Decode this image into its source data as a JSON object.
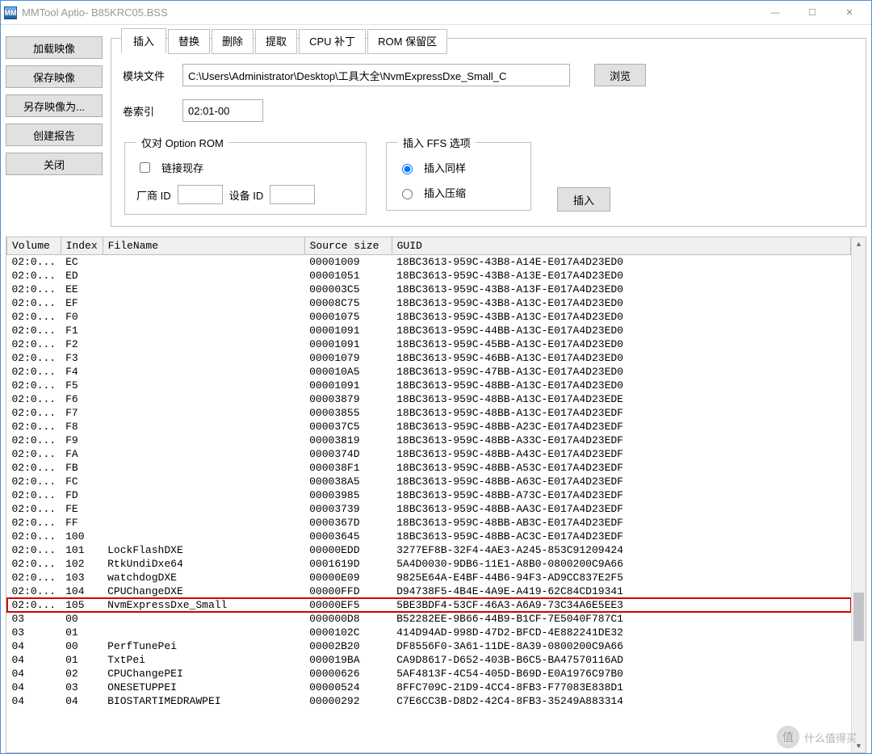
{
  "window": {
    "title": "MMTool Aptio- B85KRC05.BSS",
    "icon_label": "MM"
  },
  "left_buttons": {
    "load": "加载映像",
    "save": "保存映像",
    "saveas": "另存映像为...",
    "report": "创建报告",
    "close": "关闭"
  },
  "tabs": [
    "插入",
    "替换",
    "删除",
    "提取",
    "CPU 补丁",
    "ROM 保留区"
  ],
  "form": {
    "module_file_label": "模块文件",
    "module_file_value": "C:\\Users\\Administrator\\Desktop\\工具大全\\NvmExpressDxe_Small_C",
    "browse": "浏览",
    "volume_index_label": "卷索引",
    "volume_index_value": "02:01-00",
    "option_rom_legend": "仅对 Option ROM",
    "link_existing": "链接现存",
    "vendor_id": "厂商 ID",
    "device_id": "设备 ID",
    "ffs_legend": "插入 FFS 选项",
    "insert_same": "插入同样",
    "insert_compressed": "插入压缩",
    "insert_btn": "插入"
  },
  "columns": [
    "Volume",
    "Index",
    "FileName",
    "Source size",
    "GUID"
  ],
  "rows": [
    {
      "vol": "02:0...",
      "idx": "EC",
      "fn": "",
      "sz": "00001009",
      "guid": "18BC3613-959C-43B8-A14E-E017A4D23ED0"
    },
    {
      "vol": "02:0...",
      "idx": "ED",
      "fn": "",
      "sz": "00001051",
      "guid": "18BC3613-959C-43B8-A13E-E017A4D23ED0"
    },
    {
      "vol": "02:0...",
      "idx": "EE",
      "fn": "",
      "sz": "000003C5",
      "guid": "18BC3613-959C-43B8-A13F-E017A4D23ED0"
    },
    {
      "vol": "02:0...",
      "idx": "EF",
      "fn": "",
      "sz": "00008C75",
      "guid": "18BC3613-959C-43B8-A13C-E017A4D23ED0"
    },
    {
      "vol": "02:0...",
      "idx": "F0",
      "fn": "",
      "sz": "00001075",
      "guid": "18BC3613-959C-43BB-A13C-E017A4D23ED0"
    },
    {
      "vol": "02:0...",
      "idx": "F1",
      "fn": "",
      "sz": "00001091",
      "guid": "18BC3613-959C-44BB-A13C-E017A4D23ED0"
    },
    {
      "vol": "02:0...",
      "idx": "F2",
      "fn": "",
      "sz": "00001091",
      "guid": "18BC3613-959C-45BB-A13C-E017A4D23ED0"
    },
    {
      "vol": "02:0...",
      "idx": "F3",
      "fn": "",
      "sz": "00001079",
      "guid": "18BC3613-959C-46BB-A13C-E017A4D23ED0"
    },
    {
      "vol": "02:0...",
      "idx": "F4",
      "fn": "",
      "sz": "000010A5",
      "guid": "18BC3613-959C-47BB-A13C-E017A4D23ED0"
    },
    {
      "vol": "02:0...",
      "idx": "F5",
      "fn": "",
      "sz": "00001091",
      "guid": "18BC3613-959C-48BB-A13C-E017A4D23ED0"
    },
    {
      "vol": "02:0...",
      "idx": "F6",
      "fn": "",
      "sz": "00003879",
      "guid": "18BC3613-959C-48BB-A13C-E017A4D23EDE"
    },
    {
      "vol": "02:0...",
      "idx": "F7",
      "fn": "",
      "sz": "00003855",
      "guid": "18BC3613-959C-48BB-A13C-E017A4D23EDF"
    },
    {
      "vol": "02:0...",
      "idx": "F8",
      "fn": "",
      "sz": "000037C5",
      "guid": "18BC3613-959C-48BB-A23C-E017A4D23EDF"
    },
    {
      "vol": "02:0...",
      "idx": "F9",
      "fn": "",
      "sz": "00003819",
      "guid": "18BC3613-959C-48BB-A33C-E017A4D23EDF"
    },
    {
      "vol": "02:0...",
      "idx": "FA",
      "fn": "",
      "sz": "0000374D",
      "guid": "18BC3613-959C-48BB-A43C-E017A4D23EDF"
    },
    {
      "vol": "02:0...",
      "idx": "FB",
      "fn": "",
      "sz": "000038F1",
      "guid": "18BC3613-959C-48BB-A53C-E017A4D23EDF"
    },
    {
      "vol": "02:0...",
      "idx": "FC",
      "fn": "",
      "sz": "000038A5",
      "guid": "18BC3613-959C-48BB-A63C-E017A4D23EDF"
    },
    {
      "vol": "02:0...",
      "idx": "FD",
      "fn": "",
      "sz": "00003985",
      "guid": "18BC3613-959C-48BB-A73C-E017A4D23EDF"
    },
    {
      "vol": "02:0...",
      "idx": "FE",
      "fn": "",
      "sz": "00003739",
      "guid": "18BC3613-959C-48BB-AA3C-E017A4D23EDF"
    },
    {
      "vol": "02:0...",
      "idx": "FF",
      "fn": "",
      "sz": "0000367D",
      "guid": "18BC3613-959C-48BB-AB3C-E017A4D23EDF"
    },
    {
      "vol": "02:0...",
      "idx": "100",
      "fn": "",
      "sz": "00003645",
      "guid": "18BC3613-959C-48BB-AC3C-E017A4D23EDF"
    },
    {
      "vol": "02:0...",
      "idx": "101",
      "fn": "LockFlashDXE",
      "sz": "00000EDD",
      "guid": "3277EF8B-32F4-4AE3-A245-853C91209424"
    },
    {
      "vol": "02:0...",
      "idx": "102",
      "fn": "RtkUndiDxe64",
      "sz": "0001619D",
      "guid": "5A4D0030-9DB6-11E1-A8B0-0800200C9A66"
    },
    {
      "vol": "02:0...",
      "idx": "103",
      "fn": "watchdogDXE",
      "sz": "00000E09",
      "guid": "9825E64A-E4BF-44B6-94F3-AD9CC837E2F5"
    },
    {
      "vol": "02:0...",
      "idx": "104",
      "fn": "CPUChangeDXE",
      "sz": "00000FFD",
      "guid": "D94738F5-4B4E-4A9E-A419-62C84CD19341"
    },
    {
      "vol": "02:0...",
      "idx": "105",
      "fn": "NvmExpressDxe_Small",
      "sz": "00000EF5",
      "guid": "5BE3BDF4-53CF-46A3-A6A9-73C34A6E5EE3",
      "hl": true
    },
    {
      "vol": "03",
      "idx": "00",
      "fn": "",
      "sz": "000000D8",
      "guid": "B52282EE-9B66-44B9-B1CF-7E5040F787C1"
    },
    {
      "vol": "03",
      "idx": "01",
      "fn": "",
      "sz": "0000102C",
      "guid": "414D94AD-998D-47D2-BFCD-4E882241DE32"
    },
    {
      "vol": "04",
      "idx": "00",
      "fn": "PerfTunePei",
      "sz": "00002B20",
      "guid": "DF8556F0-3A61-11DE-8A39-0800200C9A66"
    },
    {
      "vol": "04",
      "idx": "01",
      "fn": "TxtPei",
      "sz": "000019BA",
      "guid": "CA9D8617-D652-403B-B6C5-BA47570116AD"
    },
    {
      "vol": "04",
      "idx": "02",
      "fn": "CPUChangePEI",
      "sz": "00000626",
      "guid": "5AF4813F-4C54-405D-B69D-E0A1976C97B0"
    },
    {
      "vol": "04",
      "idx": "03",
      "fn": "ONESETUPPEI",
      "sz": "00000524",
      "guid": "8FFC709C-21D9-4CC4-8FB3-F77083E838D1"
    },
    {
      "vol": "04",
      "idx": "04",
      "fn": "BIOSTARTIMEDRAWPEI",
      "sz": "00000292",
      "guid": "C7E6CC3B-D8D2-42C4-8FB3-35249A883314"
    }
  ],
  "watermark": "什么值得买"
}
